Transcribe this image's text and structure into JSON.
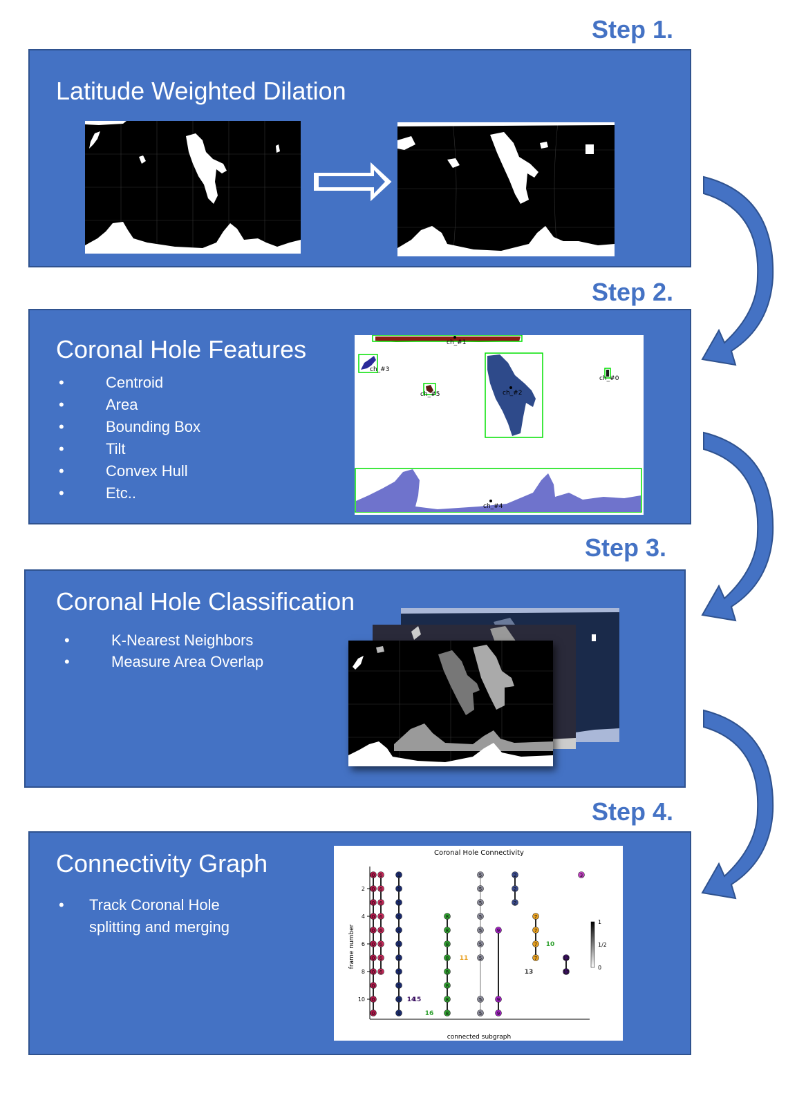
{
  "colors": {
    "panel": "#4472c4",
    "panel_border": "#2f528f",
    "step_text": "#4472c4",
    "arrow_fill": "#4472c4",
    "arrow_stroke": "#2f528f",
    "bbox": "#00e000",
    "region_dark": "#2e4a8a",
    "region_light": "#6f73cc",
    "region_brown": "#8a1d14"
  },
  "steps": {
    "s1": "Step 1.",
    "s2": "Step 2.",
    "s3": "Step 3.",
    "s4": "Step 4."
  },
  "panel1": {
    "title": "Latitude Weighted Dilation",
    "arrow_icon": "right-arrow-icon"
  },
  "panel2": {
    "title": "Coronal Hole Features",
    "bullets": [
      "Centroid",
      "Area",
      "Bounding Box",
      "Tilt",
      "Convex Hull",
      "Etc.."
    ],
    "labels": {
      "l0": "ch_#0",
      "l1": "ch_#1",
      "l2": "ch_#2",
      "l3": "ch_#3",
      "l4": "ch_#4",
      "l5": "ch_#5"
    }
  },
  "panel3": {
    "title": "Coronal Hole Classification",
    "bullets": [
      "K-Nearest Neighbors",
      "Measure Area Overlap"
    ]
  },
  "panel4": {
    "title": "Connectivity Graph",
    "bullets": [
      "Track Coronal Hole splitting and merging"
    ],
    "bullet_lines": [
      "Track Coronal Hole",
      "splitting and merging"
    ]
  },
  "chart_data": {
    "type": "scatter",
    "title": "Coronal Hole Connectivity",
    "xlabel": "connected subgraph",
    "ylabel": "frame number",
    "yticks": [
      "2",
      "4",
      "6",
      "8",
      "10"
    ],
    "ylim": [
      11,
      1
    ],
    "colorbar_ticks": [
      "1",
      "1/2",
      "0"
    ],
    "node_labels": [
      "0",
      "1",
      "2",
      "3",
      "4",
      "5",
      "6",
      "7",
      "8",
      "9",
      "10",
      "11",
      "12",
      "13",
      "14",
      "15",
      "16"
    ],
    "series": [
      {
        "label": "0",
        "color": "#b0184a",
        "frames": [
          1,
          2,
          3,
          4,
          5,
          6,
          7,
          8,
          9,
          10,
          11
        ]
      },
      {
        "label": "6",
        "color": "#c8285a",
        "frames": [
          1,
          2,
          3,
          4,
          5,
          6,
          7,
          8
        ]
      },
      {
        "label": "1",
        "color": "#1a2a6c",
        "frames": [
          1,
          2,
          3,
          4,
          5,
          6,
          7,
          8,
          9,
          10,
          11
        ]
      },
      {
        "label": "8",
        "color": "#2ea02e",
        "frames": [
          4,
          5,
          6,
          7,
          8,
          9,
          10,
          11
        ]
      },
      {
        "label": "5",
        "color": "#8a8a9a",
        "frames": [
          1,
          2,
          3,
          4,
          5,
          6,
          7,
          10,
          11
        ]
      },
      {
        "label": "9",
        "color": "#a020c0",
        "frames": [
          5,
          10,
          11
        ]
      },
      {
        "label": "2",
        "color": "#3a4a8a",
        "frames": [
          1,
          2,
          3
        ]
      },
      {
        "label": "7",
        "color": "#e8a020",
        "frames": [
          4,
          5,
          6,
          7
        ]
      },
      {
        "label": "3",
        "color": "#c040c0",
        "frames": [
          1
        ]
      },
      {
        "label": "12",
        "color": "#3a1060",
        "frames": [
          7,
          8
        ]
      }
    ],
    "annotations": [
      {
        "text": "10",
        "frame": 6
      },
      {
        "text": "11",
        "frame": 7
      },
      {
        "text": "13",
        "frame": 8
      },
      {
        "text": "14",
        "frame": 10
      },
      {
        "text": "15",
        "frame": 10
      },
      {
        "text": "16",
        "frame": 11
      }
    ]
  }
}
